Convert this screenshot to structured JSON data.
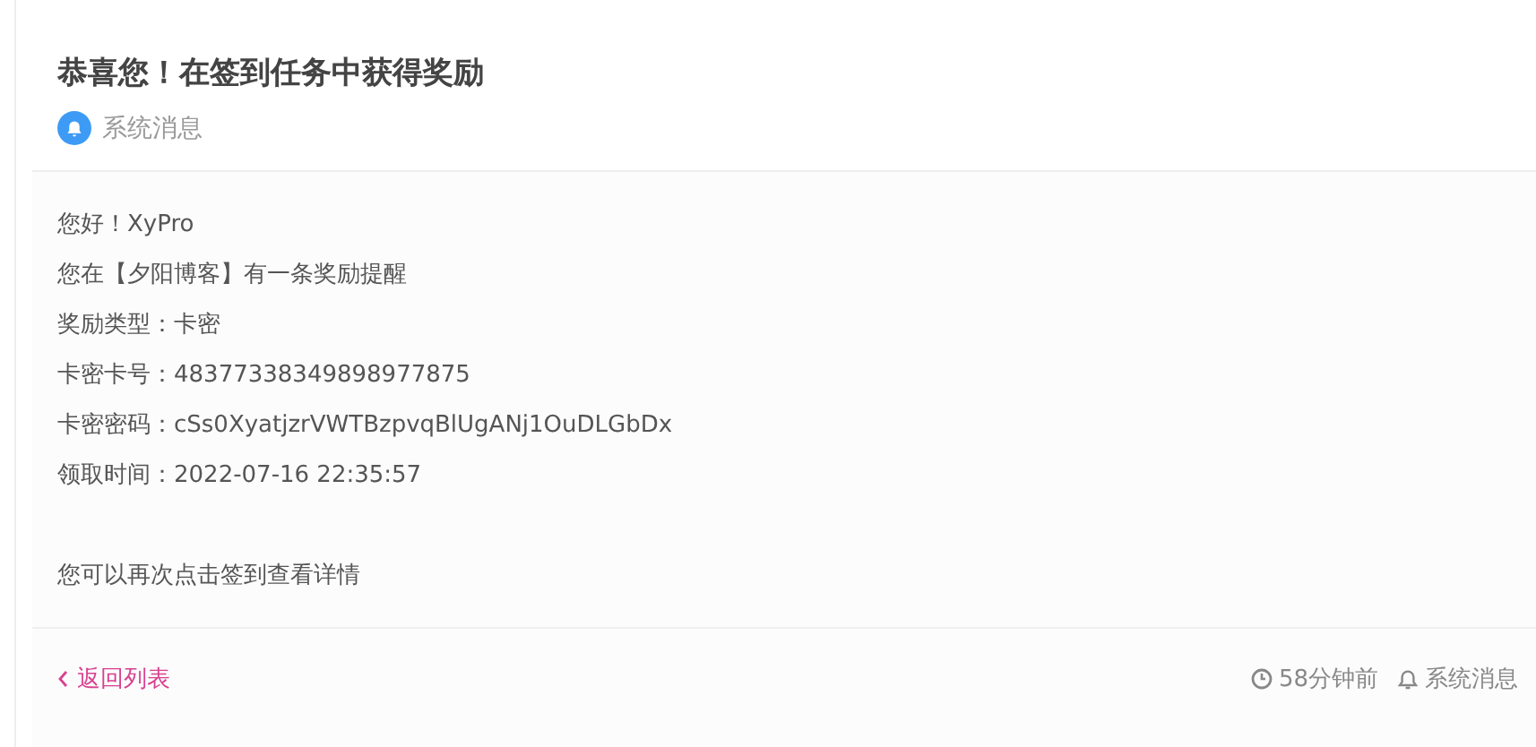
{
  "title": "恭喜您！在签到任务中获得奖励",
  "source": "系统消息",
  "body_lines": [
    "您好！XyPro",
    "您在【夕阳博客】有一条奖励提醒",
    "奖励类型：卡密",
    "卡密卡号：48377338349898977875",
    "卡密密码：cSs0XyatjzrVWTBzpvqBlUgANj1OuDLGbDx",
    "领取时间：2022-07-16 22:35:57"
  ],
  "closing": "您可以再次点击签到查看详情",
  "footer": {
    "back_link": "返回列表",
    "time": "58分钟前",
    "category": "系统消息"
  }
}
